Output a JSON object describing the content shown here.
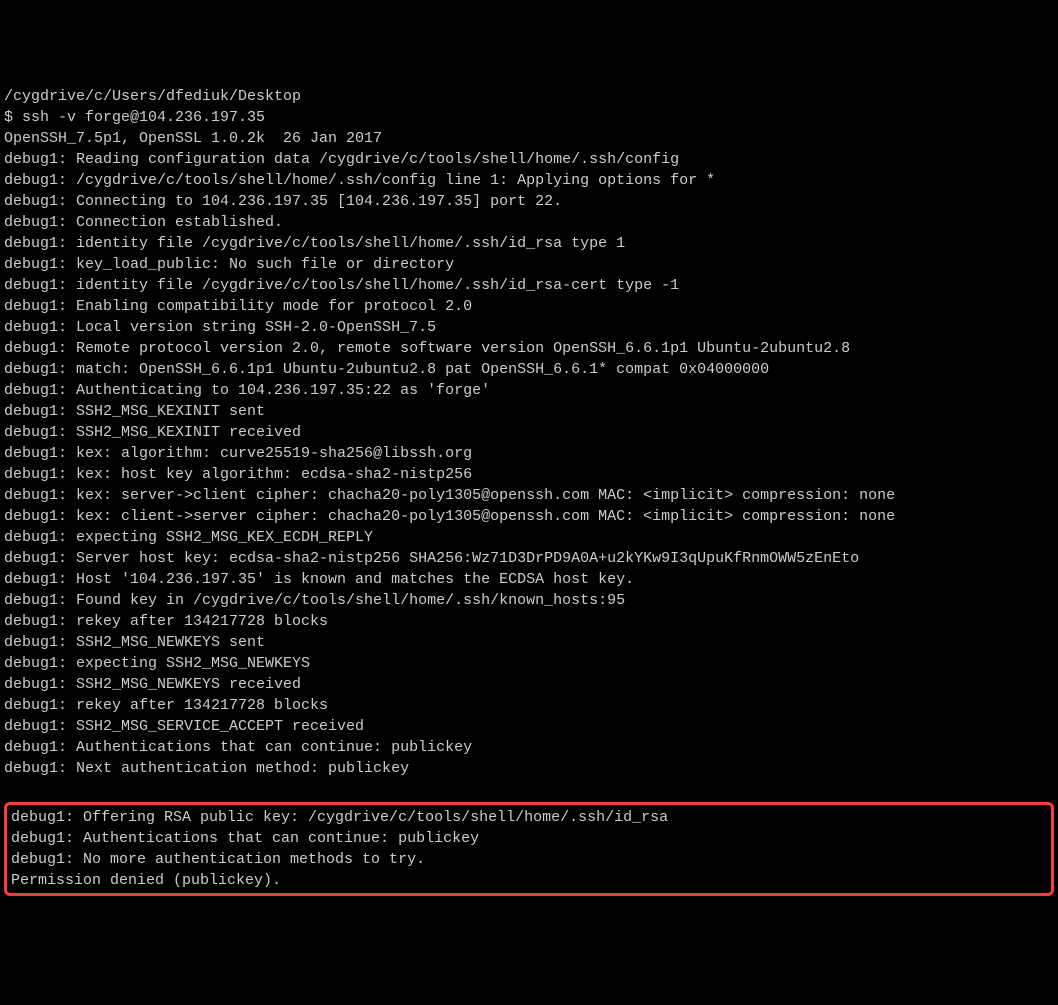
{
  "terminal": {
    "lines": [
      "/cygdrive/c/Users/dfediuk/Desktop",
      "$ ssh -v forge@104.236.197.35",
      "OpenSSH_7.5p1, OpenSSL 1.0.2k  26 Jan 2017",
      "debug1: Reading configuration data /cygdrive/c/tools/shell/home/.ssh/config",
      "debug1: /cygdrive/c/tools/shell/home/.ssh/config line 1: Applying options for *",
      "debug1: Connecting to 104.236.197.35 [104.236.197.35] port 22.",
      "debug1: Connection established.",
      "debug1: identity file /cygdrive/c/tools/shell/home/.ssh/id_rsa type 1",
      "debug1: key_load_public: No such file or directory",
      "debug1: identity file /cygdrive/c/tools/shell/home/.ssh/id_rsa-cert type -1",
      "debug1: Enabling compatibility mode for protocol 2.0",
      "debug1: Local version string SSH-2.0-OpenSSH_7.5",
      "debug1: Remote protocol version 2.0, remote software version OpenSSH_6.6.1p1 Ubuntu-2ubuntu2.8",
      "debug1: match: OpenSSH_6.6.1p1 Ubuntu-2ubuntu2.8 pat OpenSSH_6.6.1* compat 0x04000000",
      "debug1: Authenticating to 104.236.197.35:22 as 'forge'",
      "debug1: SSH2_MSG_KEXINIT sent",
      "debug1: SSH2_MSG_KEXINIT received",
      "debug1: kex: algorithm: curve25519-sha256@libssh.org",
      "debug1: kex: host key algorithm: ecdsa-sha2-nistp256",
      "debug1: kex: server->client cipher: chacha20-poly1305@openssh.com MAC: <implicit> compression: none",
      "debug1: kex: client->server cipher: chacha20-poly1305@openssh.com MAC: <implicit> compression: none",
      "debug1: expecting SSH2_MSG_KEX_ECDH_REPLY",
      "debug1: Server host key: ecdsa-sha2-nistp256 SHA256:Wz71D3DrPD9A0A+u2kYKw9I3qUpuKfRnmOWW5zEnEto",
      "debug1: Host '104.236.197.35' is known and matches the ECDSA host key.",
      "debug1: Found key in /cygdrive/c/tools/shell/home/.ssh/known_hosts:95",
      "debug1: rekey after 134217728 blocks",
      "debug1: SSH2_MSG_NEWKEYS sent",
      "debug1: expecting SSH2_MSG_NEWKEYS",
      "debug1: SSH2_MSG_NEWKEYS received",
      "debug1: rekey after 134217728 blocks",
      "debug1: SSH2_MSG_SERVICE_ACCEPT received",
      "debug1: Authentications that can continue: publickey",
      "debug1: Next authentication method: publickey"
    ],
    "highlighted_lines": [
      "debug1: Offering RSA public key: /cygdrive/c/tools/shell/home/.ssh/id_rsa",
      "debug1: Authentications that can continue: publickey",
      "debug1: No more authentication methods to try.",
      "Permission denied (publickey)."
    ]
  }
}
